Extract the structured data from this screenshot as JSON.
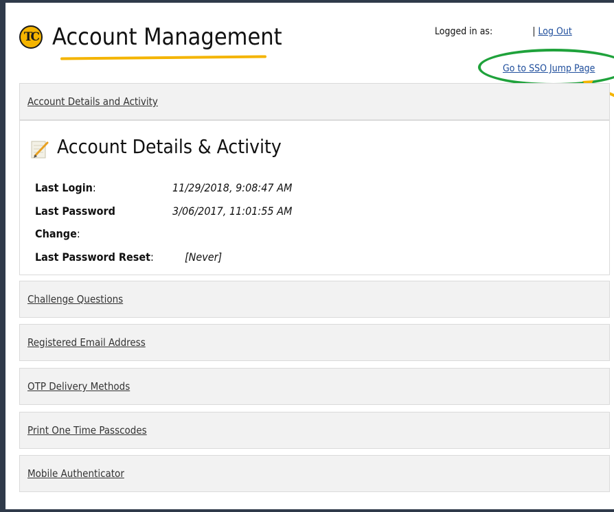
{
  "header": {
    "logo_text": "TC",
    "title": "Account Management",
    "logged_in_label": "Logged in as:",
    "logged_in_user": "",
    "separator": "|",
    "logout_label": "Log Out",
    "sso_link_label": "Go to SSO Jump Page"
  },
  "sections": {
    "account_details": "Account Details and Activity",
    "challenge_questions": "Challenge Questions",
    "registered_email": "Registered Email Address",
    "otp_delivery": "OTP Delivery Methods",
    "print_otp": "Print One Time Passcodes",
    "mobile_auth": "Mobile Authenticator"
  },
  "details_panel": {
    "heading": "Account Details & Activity",
    "last_login_label": "Last Login",
    "last_login_value": "11/29/2018, 9:08:47 AM",
    "last_password_change_label_1": "Last Password",
    "last_password_change_label_2": "Change",
    "last_password_change_value": "3/06/2017, 11:01:55 AM",
    "last_password_reset_label": "Last Password Reset",
    "last_password_reset_value": "[Never]",
    "colon": ":"
  },
  "colors": {
    "brand_yellow": "#f4b400",
    "link_blue": "#1f4e9c",
    "highlight_green": "#1fa23b",
    "arrow_orange": "#f4b400"
  },
  "icons": [
    "tc-logo-icon",
    "notepad-icon",
    "annotation-arrow-icon"
  ]
}
